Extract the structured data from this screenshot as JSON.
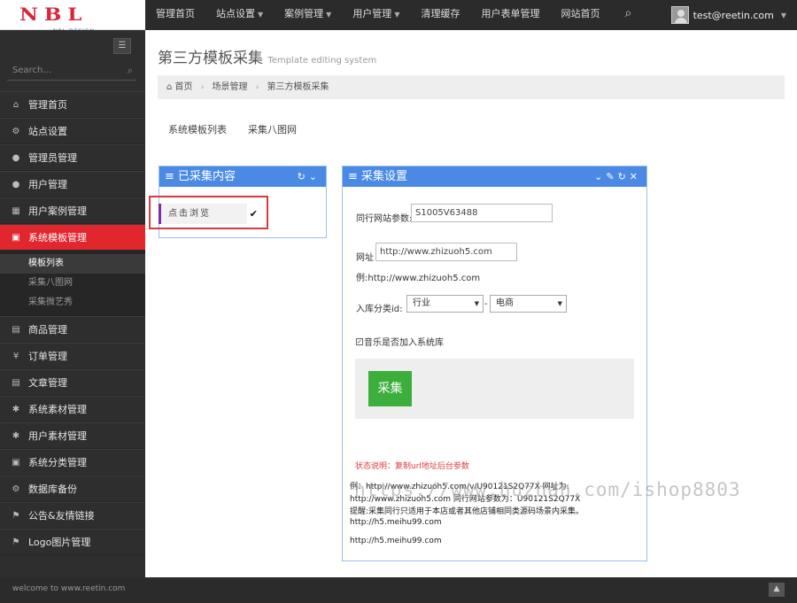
{
  "logo": {
    "letters": "NBL",
    "tagline": "NBL DESIGN"
  },
  "topnav": [
    {
      "label": "管理首页",
      "dropdown": false
    },
    {
      "label": "站点设置",
      "dropdown": true
    },
    {
      "label": "案例管理",
      "dropdown": true
    },
    {
      "label": "用户管理",
      "dropdown": true
    },
    {
      "label": "清理缓存",
      "dropdown": false
    },
    {
      "label": "用户表单管理",
      "dropdown": false
    },
    {
      "label": "网站首页",
      "dropdown": false
    }
  ],
  "user": {
    "email": "test@reetin.com"
  },
  "sidebar": {
    "search_placeholder": "Search...",
    "items": [
      {
        "label": "管理首页",
        "icon": "home-icon"
      },
      {
        "label": "站点设置",
        "icon": "cogs-icon"
      },
      {
        "label": "管理员管理",
        "icon": "user-icon"
      },
      {
        "label": "用户管理",
        "icon": "user-icon"
      },
      {
        "label": "用户案例管理",
        "icon": "table-icon"
      },
      {
        "label": "系统模板管理",
        "icon": "briefcase-icon",
        "active": true
      },
      {
        "label": "商品管理",
        "icon": "box-icon"
      },
      {
        "label": "订单管理",
        "icon": "yen-icon"
      },
      {
        "label": "文章管理",
        "icon": "box-icon"
      },
      {
        "label": "系统素材管理",
        "icon": "gift-icon"
      },
      {
        "label": "用户素材管理",
        "icon": "gift-icon"
      },
      {
        "label": "系统分类管理",
        "icon": "briefcase-icon"
      },
      {
        "label": "数据库备份",
        "icon": "cogs-icon"
      },
      {
        "label": "公告&友情链接",
        "icon": "bookmark-icon"
      },
      {
        "label": "Logo图片管理",
        "icon": "bookmark-icon"
      }
    ],
    "subitems": [
      "模板列表",
      "采集八图网",
      "采集微艺秀"
    ]
  },
  "page": {
    "title": "第三方模板采集",
    "subtitle": "Template editing system",
    "breadcrumb": [
      "首页",
      "场景管理",
      "第三方模板采集"
    ],
    "tabs": [
      "系统模板列表",
      "采集八图网"
    ]
  },
  "collected_panel": {
    "title": "已采集内容",
    "browse_label": "点击浏览"
  },
  "settings_panel": {
    "title": "采集设置",
    "param_label": "同行网站参数:",
    "param_value": "S1005V63488",
    "url_label": "网址",
    "url_value": "http://www.zhizuoh5.com",
    "url_example": "例:http://www.zhizuoh5.com",
    "category_label": "入库分类id:",
    "category_sep": "-",
    "category1": "行业",
    "category2": "电商",
    "checkbox_label": "音乐是否加入系统库",
    "checkbox_checked": true,
    "submit_label": "采集",
    "status_note": "状态说明：复制url地址后台参数",
    "note_lines": [
      "例：http://www.zhizuoh5.com/v/U90121S2Q77X 网址为:",
      "http://www.zhizuoh5.com 同行网站参数为：U90121S2Q77X",
      "提醒:采集同行只适用于本店或者其他店铺相同类源码场景内采集。",
      "http://h5.meihu99.com",
      "http://h5.meihu99.com"
    ]
  },
  "watermark": "https://www.huzhan.com/ishop8803",
  "footer": {
    "text": "welcome to www.reetin.com"
  }
}
